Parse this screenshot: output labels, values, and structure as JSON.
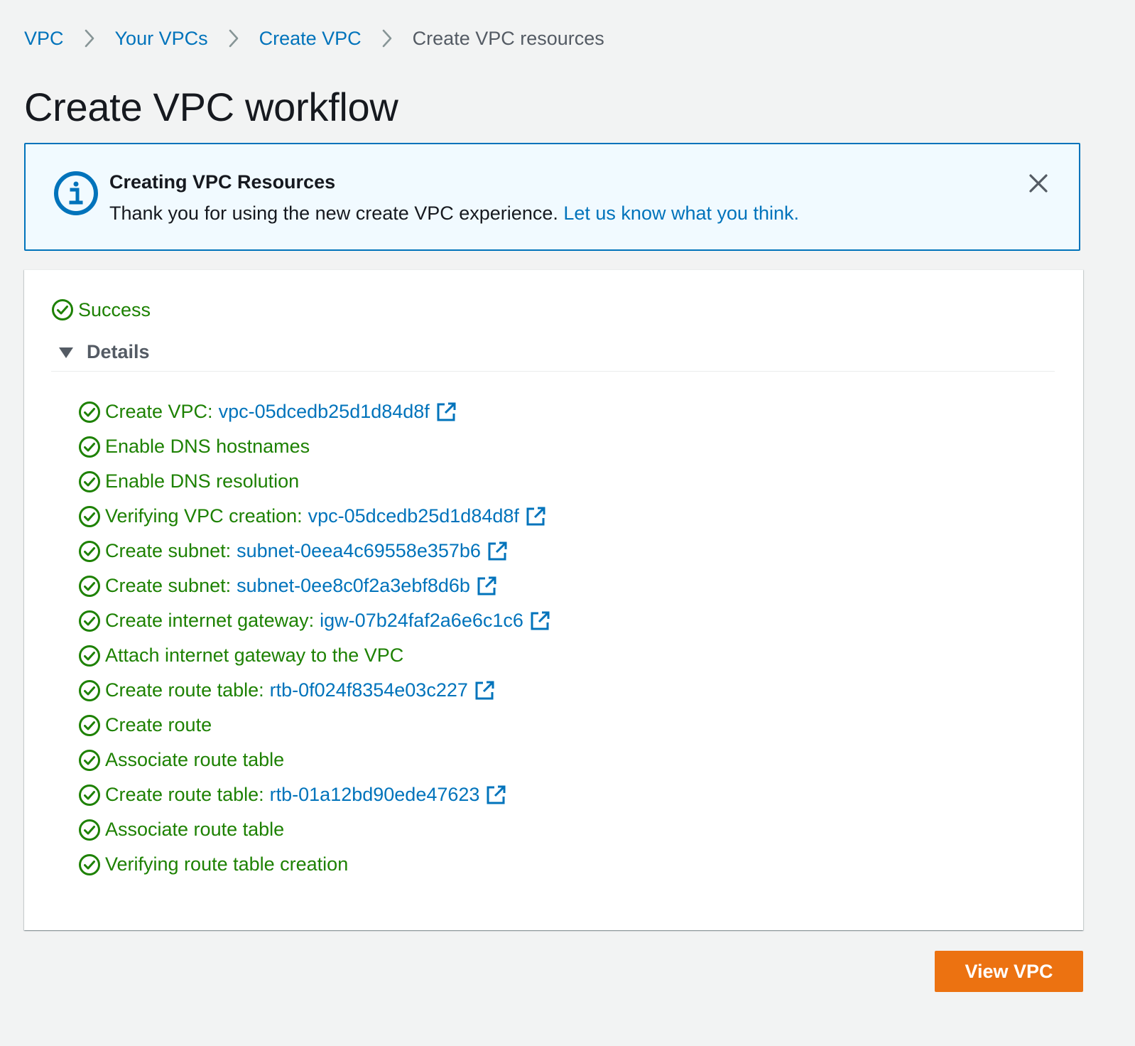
{
  "breadcrumb": {
    "items": [
      {
        "label": "VPC"
      },
      {
        "label": "Your VPCs"
      },
      {
        "label": "Create VPC"
      }
    ],
    "current": "Create VPC resources"
  },
  "page": {
    "title": "Create VPC workflow"
  },
  "flash": {
    "title": "Creating VPC Resources",
    "message": "Thank you for using the new create VPC experience.",
    "link": "Let us know what you think.",
    "icon": "info-icon",
    "close_icon": "close-icon"
  },
  "status": {
    "label": "Success",
    "icon": "check-circle-icon"
  },
  "details": {
    "label": "Details",
    "expanded": true,
    "steps": [
      {
        "text": "Create VPC:",
        "link": "vpc-05dcedb25d1d84d8f"
      },
      {
        "text": "Enable DNS hostnames",
        "link": ""
      },
      {
        "text": "Enable DNS resolution",
        "link": ""
      },
      {
        "text": "Verifying VPC creation:",
        "link": "vpc-05dcedb25d1d84d8f"
      },
      {
        "text": "Create subnet:",
        "link": "subnet-0eea4c69558e357b6"
      },
      {
        "text": "Create subnet:",
        "link": "subnet-0ee8c0f2a3ebf8d6b"
      },
      {
        "text": "Create internet gateway:",
        "link": "igw-07b24faf2a6e6c1c6"
      },
      {
        "text": "Attach internet gateway to the VPC",
        "link": ""
      },
      {
        "text": "Create route table:",
        "link": "rtb-0f024f8354e03c227"
      },
      {
        "text": "Create route",
        "link": ""
      },
      {
        "text": "Associate route table",
        "link": ""
      },
      {
        "text": "Create route table:",
        "link": "rtb-01a12bd90ede47623"
      },
      {
        "text": "Associate route table",
        "link": ""
      },
      {
        "text": "Verifying route table creation",
        "link": ""
      }
    ]
  },
  "actions": {
    "view_vpc": "View VPC"
  },
  "colors": {
    "link": "#0073bb",
    "success": "#1d8102",
    "primary_button": "#ec7211",
    "info_border": "#0073bb",
    "info_background": "#f1faff",
    "page_background": "#f2f3f3"
  }
}
